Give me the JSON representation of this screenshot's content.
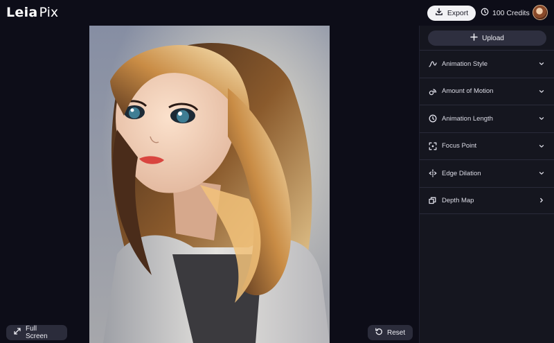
{
  "app": {
    "logo_primary": "Leia",
    "logo_secondary": "Pix"
  },
  "header": {
    "export_label": "Export",
    "credits_label": "100 Credits",
    "export_icon": "download-icon",
    "credits_icon": "clock-icon"
  },
  "stage": {
    "fullscreen_label": "Full Screen",
    "reset_label": "Reset"
  },
  "panel": {
    "upload_label": "Upload",
    "items": [
      {
        "label": "Animation Style",
        "icon": "animation-style-icon",
        "chevron": "chevron-down-icon"
      },
      {
        "label": "Amount of Motion",
        "icon": "motion-icon",
        "chevron": "chevron-down-icon"
      },
      {
        "label": "Animation Length",
        "icon": "clock-icon",
        "chevron": "chevron-down-icon"
      },
      {
        "label": "Focus Point",
        "icon": "focus-icon",
        "chevron": "chevron-down-icon"
      },
      {
        "label": "Edge Dilation",
        "icon": "edge-dilation-icon",
        "chevron": "chevron-down-icon"
      },
      {
        "label": "Depth Map",
        "icon": "depth-map-icon",
        "chevron": "chevron-right-icon"
      }
    ]
  },
  "colors": {
    "background": "#0d0d18",
    "panel": "#15161f",
    "button_dark": "#2e2f3f",
    "button_light": "#f2f2f5"
  }
}
